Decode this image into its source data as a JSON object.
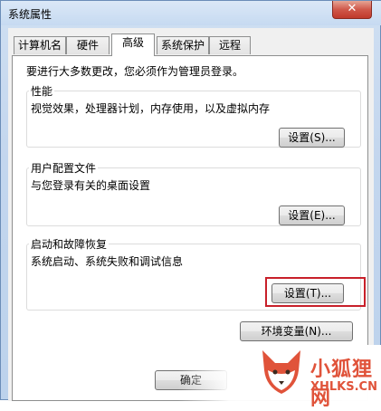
{
  "window": {
    "title": "系统属性",
    "close_glyph": "✕"
  },
  "tabs": [
    {
      "label": "计算机名"
    },
    {
      "label": "硬件"
    },
    {
      "label": "高级",
      "active": true
    },
    {
      "label": "系统保护"
    },
    {
      "label": "远程"
    }
  ],
  "notice": "要进行大多数更改，您必须作为管理员登录。",
  "performance": {
    "title": "性能",
    "desc": "视觉效果，处理器计划，内存使用，以及虚拟内存",
    "button": "设置(S)..."
  },
  "user_profiles": {
    "title": "用户配置文件",
    "desc": "与您登录有关的桌面设置",
    "button": "设置(E)..."
  },
  "startup_recovery": {
    "title": "启动和故障恢复",
    "desc": "系统启动、系统失败和调试信息",
    "button": "设置(T)..."
  },
  "env_button": "环境变量(N)...",
  "ok_button": "确定",
  "watermark": {
    "text_cn": "小狐狸网",
    "url": "XHLKS.CN"
  },
  "colors": {
    "highlight": "#c8202a",
    "watermark": "#e0533a",
    "title_bar": "#c6daf1"
  }
}
